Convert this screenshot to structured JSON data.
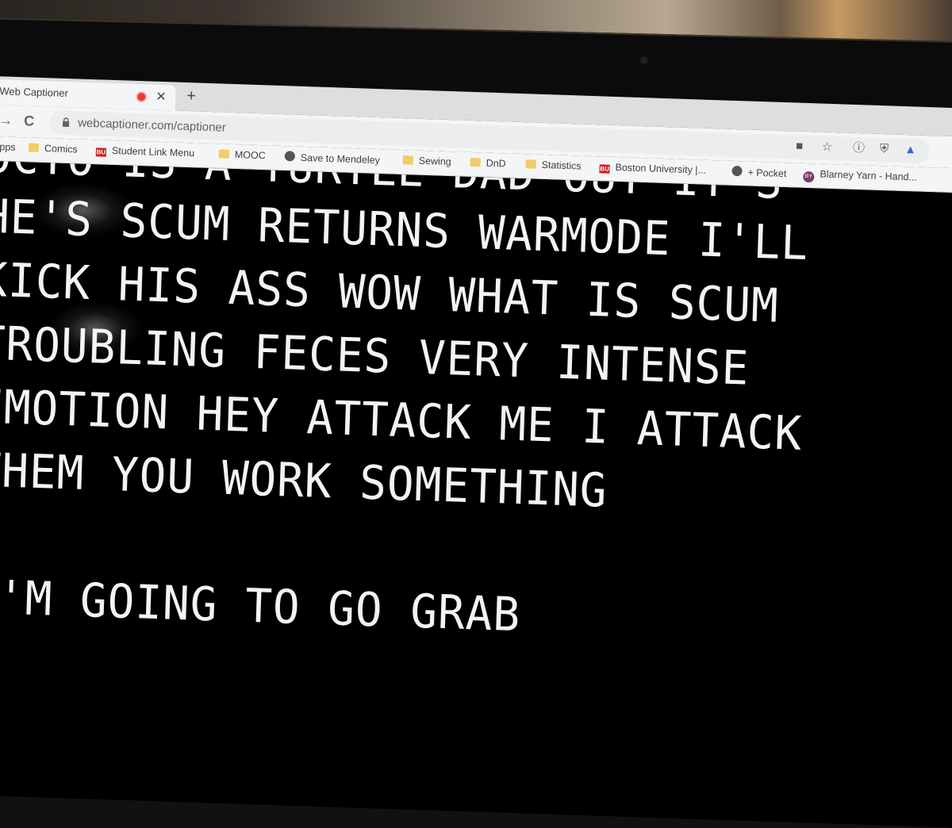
{
  "browser": {
    "tab_title": "Web Captioner",
    "new_tab": "+",
    "close": "✕",
    "back": "→",
    "reload": "C",
    "url": "webcaptioner.com/captioner"
  },
  "bookmarks": [
    {
      "label": "Apps",
      "icon": "apps-icon"
    },
    {
      "label": "Comics",
      "icon": "folder-icon"
    },
    {
      "label": "Student Link Menu",
      "icon": "bu-icon"
    },
    {
      "label": "MOOC",
      "icon": "folder-icon"
    },
    {
      "label": "Save to Mendeley",
      "icon": "globe-icon"
    },
    {
      "label": "Sewing",
      "icon": "folder-icon"
    },
    {
      "label": "DnD",
      "icon": "folder-icon"
    },
    {
      "label": "Statistics",
      "icon": "folder-icon"
    },
    {
      "label": "Boston University |...",
      "icon": "bu-icon"
    },
    {
      "label": "+ Pocket",
      "icon": "globe-icon"
    },
    {
      "label": "Blarney Yarn - Hand...",
      "icon": "by-icon"
    }
  ],
  "captions": [
    "OCTO IS A TURTLE DAD OUT IT S",
    "HE'S SCUM RETURNS WARMODE I'LL",
    "KICK HIS ASS WOW WHAT IS SCUM",
    "TROUBLING FECES VERY INTENSE",
    "EMOTION HEY ATTACK ME I ATTACK",
    "THEM YOU WORK SOMETHING",
    "I'M GOING TO GO GRAB"
  ]
}
